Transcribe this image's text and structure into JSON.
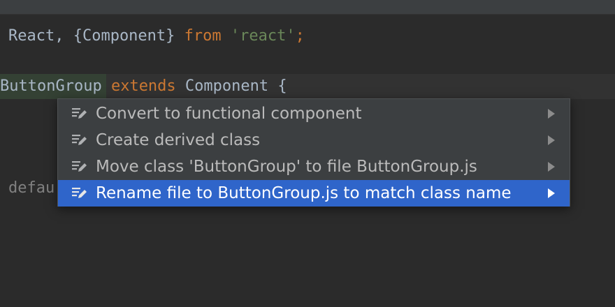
{
  "editor": {
    "line1": {
      "t1": "React, {Component} ",
      "kw": "from",
      "sp": " ",
      "str": "'react'",
      "semi": ";"
    },
    "line2": {
      "cls": "ButtonGroup",
      "sp1": " ",
      "kw": "extends",
      "sp2": " ",
      "rest": "Component {"
    },
    "line3": {
      "text": "defau"
    }
  },
  "popup": {
    "items": [
      {
        "label": "Convert to functional component",
        "icon": "edit-icon",
        "arrow": "submenu-arrow-icon",
        "selected": false
      },
      {
        "label": "Create derived class",
        "icon": "edit-icon",
        "arrow": "submenu-arrow-icon",
        "selected": false
      },
      {
        "label": "Move class 'ButtonGroup' to file ButtonGroup.js",
        "icon": "edit-icon",
        "arrow": "submenu-arrow-icon",
        "selected": false
      },
      {
        "label": "Rename file to ButtonGroup.js to match class name",
        "icon": "edit-icon",
        "arrow": "submenu-arrow-icon",
        "selected": true
      }
    ]
  },
  "colors": {
    "background": "#2b2b2b",
    "popup_bg": "#3c3f41",
    "selection": "#2f65ca",
    "keyword": "#cc7832",
    "string": "#6a8759",
    "text": "#a9b7c6"
  }
}
